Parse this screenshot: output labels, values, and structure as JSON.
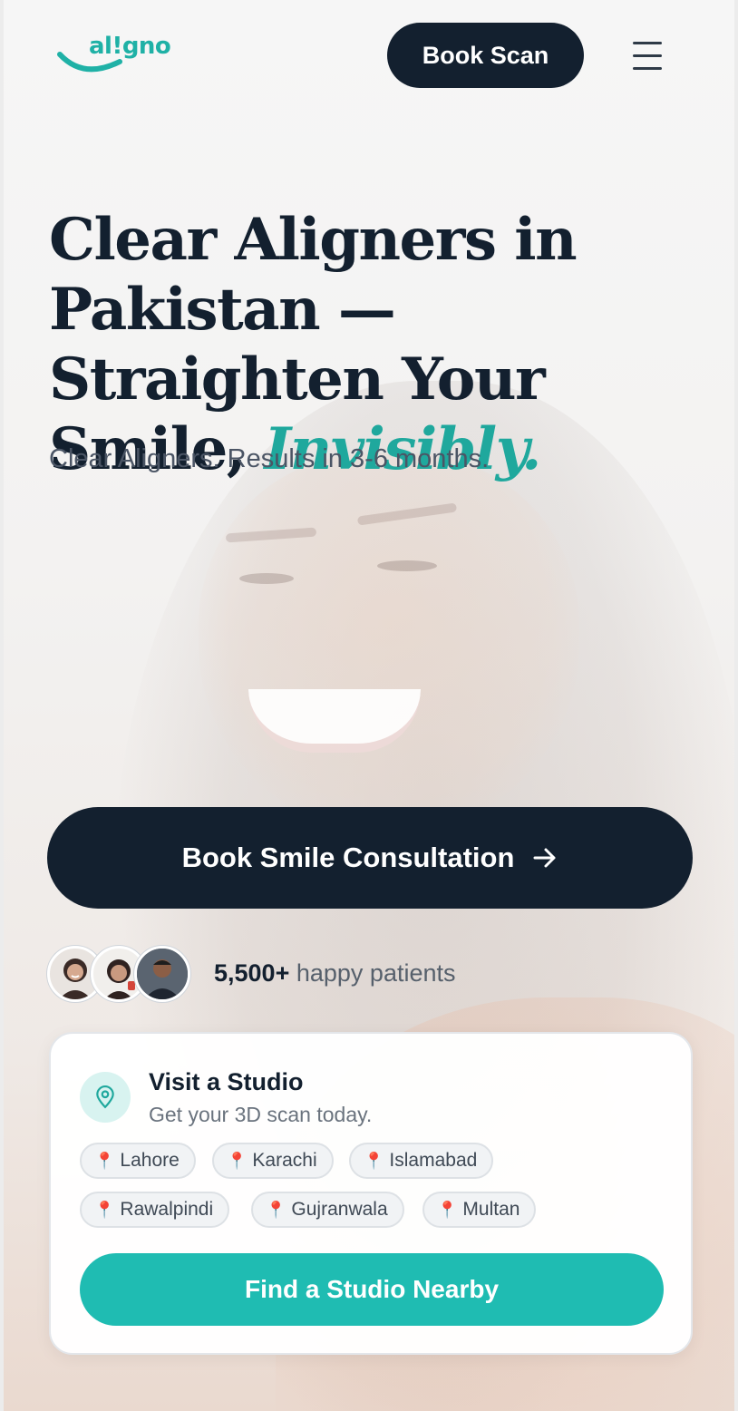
{
  "brand": {
    "logo_text": "al!gno",
    "accent_color": "#1fb1a6",
    "dark_color": "#13202f"
  },
  "header": {
    "book_scan_label": "Book Scan",
    "menu_icon": "hamburger-menu-icon"
  },
  "hero": {
    "headline_part1": "Clear Aligners in Pakistan — Straighten Your Smile, ",
    "headline_accent": "Invisibly.",
    "subheadline": "Clear Aligners. Results in 3-6 months.",
    "cta_label": "Book Smile Consultation",
    "cta_icon": "arrow-right-icon"
  },
  "social_proof": {
    "count": "5,500+",
    "label": "happy patients"
  },
  "studio_card": {
    "title": "Visit a Studio",
    "subtitle": "Get your 3D scan today.",
    "cities": [
      "Lahore",
      "Karachi",
      "Islamabad",
      "Rawalpindi",
      "Gujranwala",
      "Multan"
    ],
    "find_label": "Find a Studio Nearby"
  }
}
